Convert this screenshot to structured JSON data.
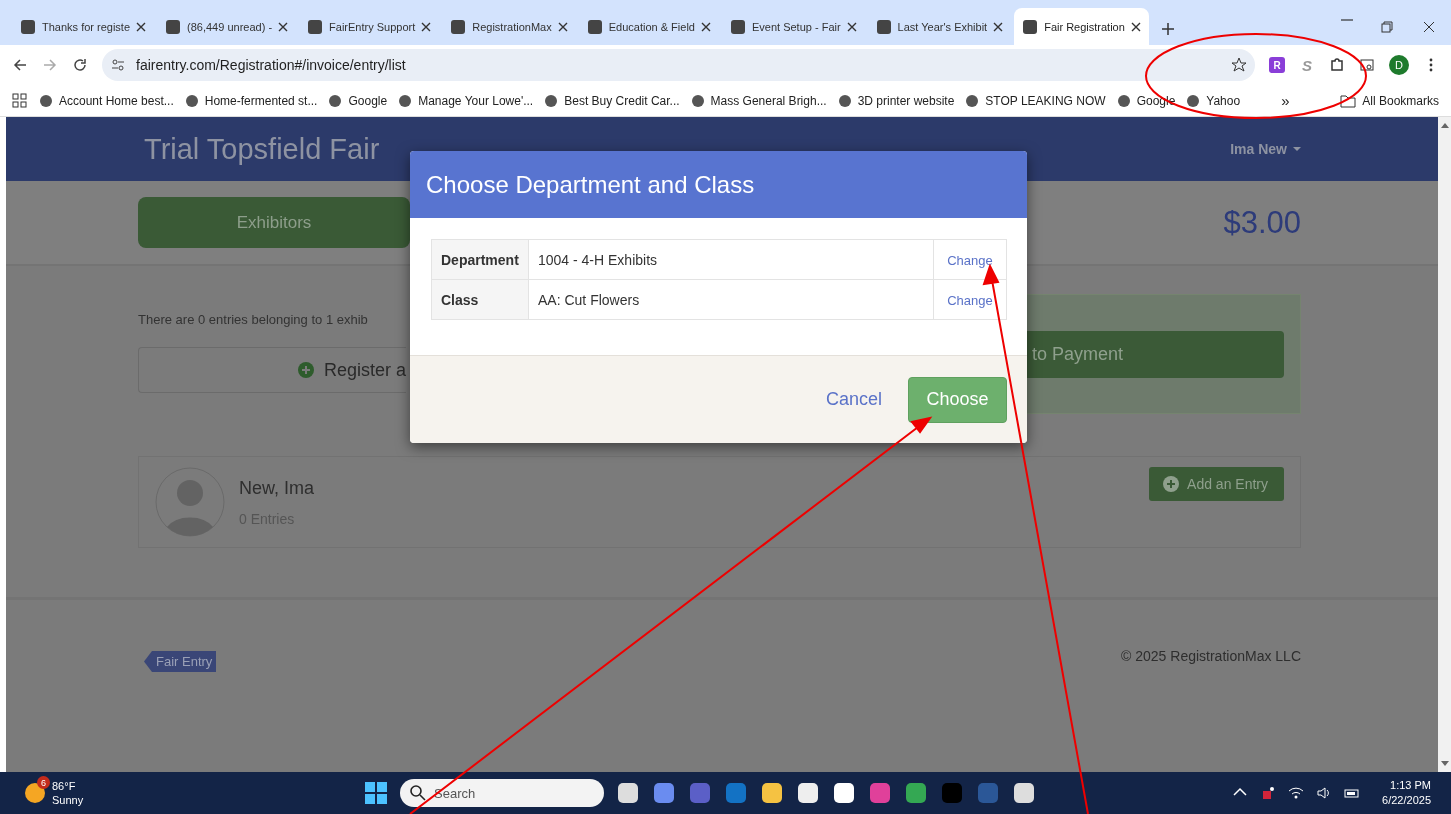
{
  "browser": {
    "tabs": [
      {
        "title": "Thanks for registe",
        "selected": false
      },
      {
        "title": "(86,449 unread) -",
        "selected": false
      },
      {
        "title": "FairEntry Support",
        "selected": false
      },
      {
        "title": "RegistrationMax",
        "selected": false
      },
      {
        "title": "Education & Field",
        "selected": false
      },
      {
        "title": "Event Setup - Fair",
        "selected": false
      },
      {
        "title": "Last Year's Exhibit",
        "selected": false
      },
      {
        "title": "Fair Registration",
        "selected": true
      }
    ],
    "address": "fairentry.com/Registration#/invoice/entry/list",
    "extensions": [
      "R",
      "S"
    ],
    "profile": "D",
    "bookmarks": [
      {
        "label": "Account Home best..."
      },
      {
        "label": "Home-fermented st..."
      },
      {
        "label": "Google"
      },
      {
        "label": "Manage Your Lowe'..."
      },
      {
        "label": "Best Buy Credit Car..."
      },
      {
        "label": "Mass General Brigh..."
      },
      {
        "label": "3D printer website"
      },
      {
        "label": "STOP LEAKING NOW"
      },
      {
        "label": "Google"
      },
      {
        "label": "Yahoo"
      }
    ],
    "more": "»",
    "all_bookmarks": "All Bookmarks"
  },
  "page": {
    "title": "Trial Topsfield Fair",
    "user": "Ima New",
    "nav_tab": "Exhibitors",
    "total": "$3.00",
    "info_text": "There are 0 entries belonging to 1 exhib",
    "register_button": "Register a",
    "payment_button": "to Payment",
    "exhibitor": {
      "name": "New, Ima",
      "entries": "0 Entries",
      "add_button": "Add an Entry"
    },
    "footer": {
      "logo": "Fair Entry",
      "copyright": "© 2025 RegistrationMax LLC"
    }
  },
  "modal": {
    "title": "Choose Department and Class",
    "rows": [
      {
        "label": "Department",
        "value": "1004 - 4-H Exhibits",
        "action": "Change"
      },
      {
        "label": "Class",
        "value": "AA: Cut Flowers",
        "action": "Change"
      }
    ],
    "cancel": "Cancel",
    "choose": "Choose"
  },
  "taskbar": {
    "weather_badge": "6",
    "temperature": "86°F",
    "condition": "Sunny",
    "search_placeholder": "Search",
    "time": "1:13 PM",
    "date": "6/22/2025"
  }
}
